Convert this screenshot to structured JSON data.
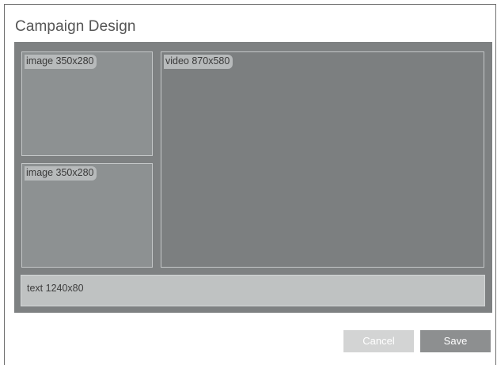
{
  "dialog": {
    "title": "Campaign Design"
  },
  "canvas": {
    "slots": [
      {
        "type": "image",
        "label": "image 350x280"
      },
      {
        "type": "image",
        "label": "image 350x280"
      },
      {
        "type": "video",
        "label": "video 870x580"
      },
      {
        "type": "text",
        "label": "text 1240x80"
      }
    ]
  },
  "actions": {
    "cancel_label": "Cancel",
    "save_label": "Save"
  },
  "colors": {
    "canvas_bg": "#7e8182",
    "save_button": "#8d8f90",
    "cancel_button": "#d3d4d4"
  }
}
